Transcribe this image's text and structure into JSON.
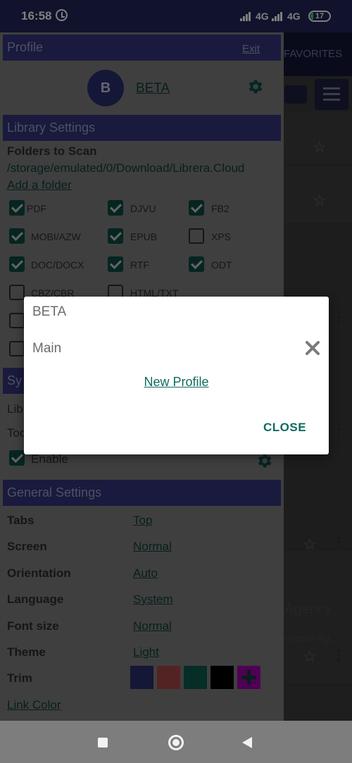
{
  "status_bar": {
    "time": "16:58",
    "network1": "4G",
    "network2": "4G",
    "battery": "17"
  },
  "background_app": {
    "tab_label": "FAVORITES",
    "item_title": "Agency",
    "item_subtitle": "etective Ag...",
    "item_partial": "..."
  },
  "profile": {
    "header": "Profile",
    "exit": "Exit",
    "avatar_letter": "B",
    "name": "BETA"
  },
  "library": {
    "header": "Library Settings",
    "folders_label": "Folders to Scan",
    "folder_path": "/storage/emulated/0/Download/Librera.Cloud",
    "add_folder": "Add a folder",
    "formats": [
      {
        "label": "PDF",
        "checked": true
      },
      {
        "label": "DJVU",
        "checked": true
      },
      {
        "label": "FB2",
        "checked": true
      },
      {
        "label": "MOBI/AZW",
        "checked": true
      },
      {
        "label": "EPUB",
        "checked": true
      },
      {
        "label": "XPS",
        "checked": false
      },
      {
        "label": "DOC/DOCX",
        "checked": true
      },
      {
        "label": "RTF",
        "checked": true
      },
      {
        "label": "ODT",
        "checked": true
      },
      {
        "label": "CBZ/CBR",
        "checked": false
      },
      {
        "label": "HTML/TXT",
        "checked": false
      }
    ]
  },
  "sync": {
    "header_partial": "Sy",
    "line1_partial": "Lib",
    "line2_partial": "Too",
    "enable_label": "Enable"
  },
  "general": {
    "header": "General Settings",
    "rows": [
      {
        "label": "Tabs",
        "value": "Top"
      },
      {
        "label": "Screen",
        "value": "Normal"
      },
      {
        "label": "Orientation",
        "value": "Auto"
      },
      {
        "label": "Language",
        "value": "System"
      },
      {
        "label": "Font size",
        "value": "Normal"
      },
      {
        "label": "Theme",
        "value": "Light"
      }
    ],
    "trim_label": "Trim",
    "link_color_label": "Link Color",
    "trim_colors": [
      "#2b2f6e",
      "#a64545",
      "#0c5a4f",
      "#000000",
      "#a000a8"
    ]
  },
  "dialog": {
    "profile_1": "BETA",
    "profile_2": "Main",
    "new_profile": "New Profile",
    "close": "CLOSE"
  },
  "colors": {
    "header_bg": "#32357a",
    "accent_teal": "#0f6b60",
    "scrim": "rgba(0,0,0,0.5)"
  }
}
